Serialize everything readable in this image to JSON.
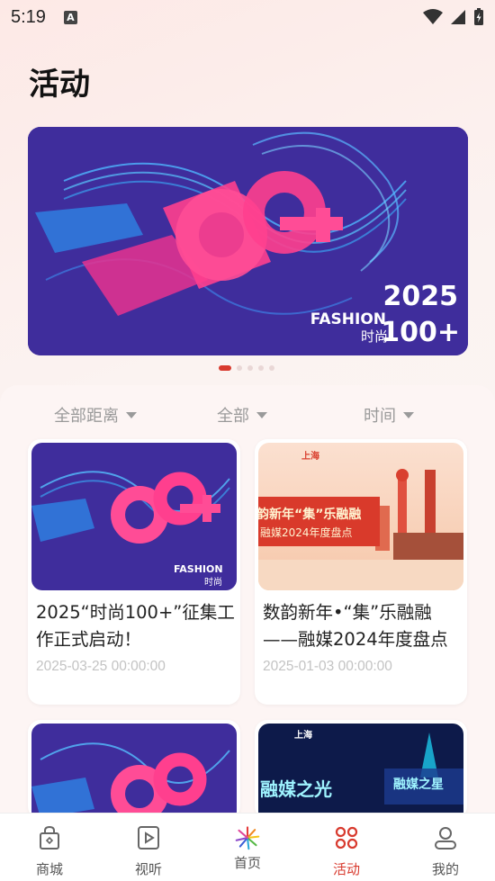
{
  "status": {
    "time": "5:19",
    "a_icon": "A"
  },
  "page": {
    "title": "活动"
  },
  "banner": {
    "year": "2025",
    "brand": "FASHION",
    "brand_cn": "时尚",
    "number": "100+"
  },
  "filters": [
    {
      "label": "全部距离"
    },
    {
      "label": "全部"
    },
    {
      "label": "时间"
    }
  ],
  "cards": [
    {
      "title": "2025“时尚100+”征集工作正式启动！",
      "date": "2025-03-25 00:00:00"
    },
    {
      "title": "数韵新年•“集”乐融融——融媒2024年度盘点",
      "date": "2025-01-03 00:00:00",
      "img_logo": "上海",
      "img_line1": "韵新年“集”乐融融",
      "img_line2": "融媒2024年度盘点"
    },
    {
      "title": "",
      "date": ""
    },
    {
      "title": "",
      "date": "",
      "img_logo": "上海",
      "img_line1": "融媒之光",
      "img_line2": "融媒之星"
    }
  ],
  "nav": [
    {
      "label": "商城",
      "icon": "shopping-bag-icon"
    },
    {
      "label": "视听",
      "icon": "play-icon"
    },
    {
      "label": "首页",
      "icon": "home-logo-icon"
    },
    {
      "label": "活动",
      "icon": "activity-grid-icon",
      "active": true
    },
    {
      "label": "我的",
      "icon": "profile-icon"
    }
  ],
  "colors": {
    "accent": "#d83a2e",
    "banner_bg": "#3f2d9c"
  }
}
